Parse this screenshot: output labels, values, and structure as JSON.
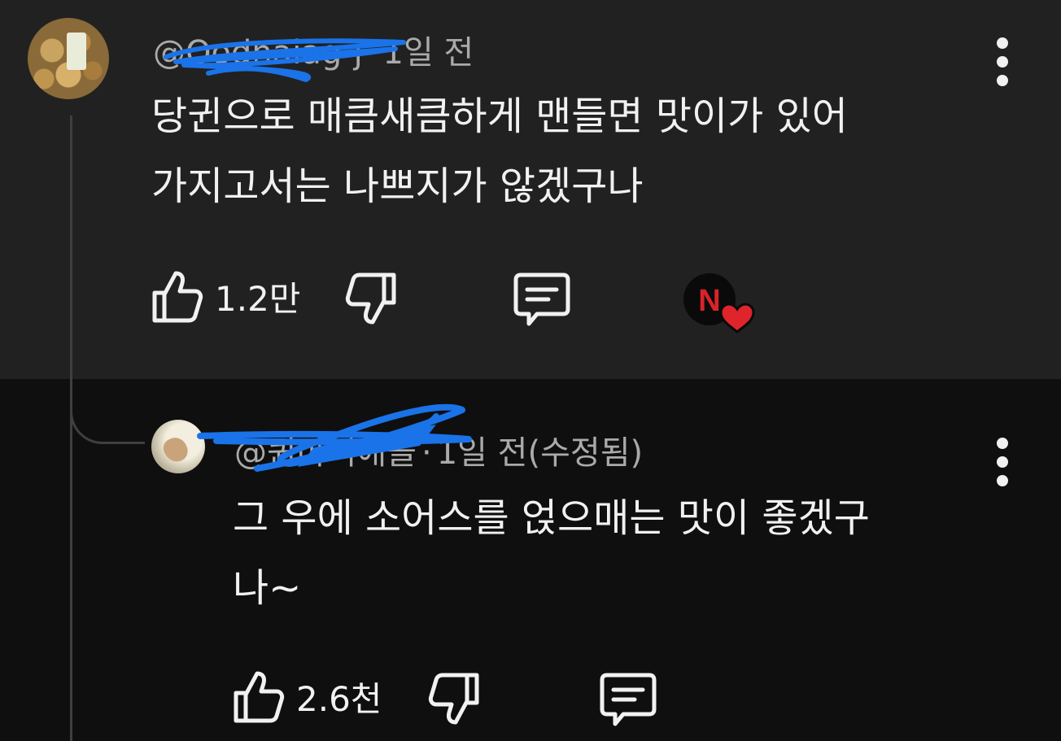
{
  "comment": {
    "handle": "@Qodnaiag-j",
    "time": "1일 전",
    "lines": [
      "당귄으로 매큼새큼하게 맨들면 맛이가 있어",
      "가지고서는 나쁘지가 않겠구나"
    ],
    "like_count": "1.2만",
    "creator_heart": "N"
  },
  "reply": {
    "handle": "@퀸마리애들",
    "time": "1일 전(수정됨)",
    "lines": [
      "그 우에 소어스를 얹으매는 맛이 좋겠구",
      "나~"
    ],
    "like_count": "2.6천"
  },
  "icons": {
    "like": "thumbs-up-icon",
    "dislike": "thumbs-down-icon",
    "reply": "comment-icon",
    "more": "more-vertical-icon",
    "heart": "creator-heart-icon"
  },
  "colors": {
    "parent_background": "#212121",
    "reply_background": "#0f0f0f",
    "redaction_scribble": "#1a73e8",
    "heart": "#e0242b"
  }
}
